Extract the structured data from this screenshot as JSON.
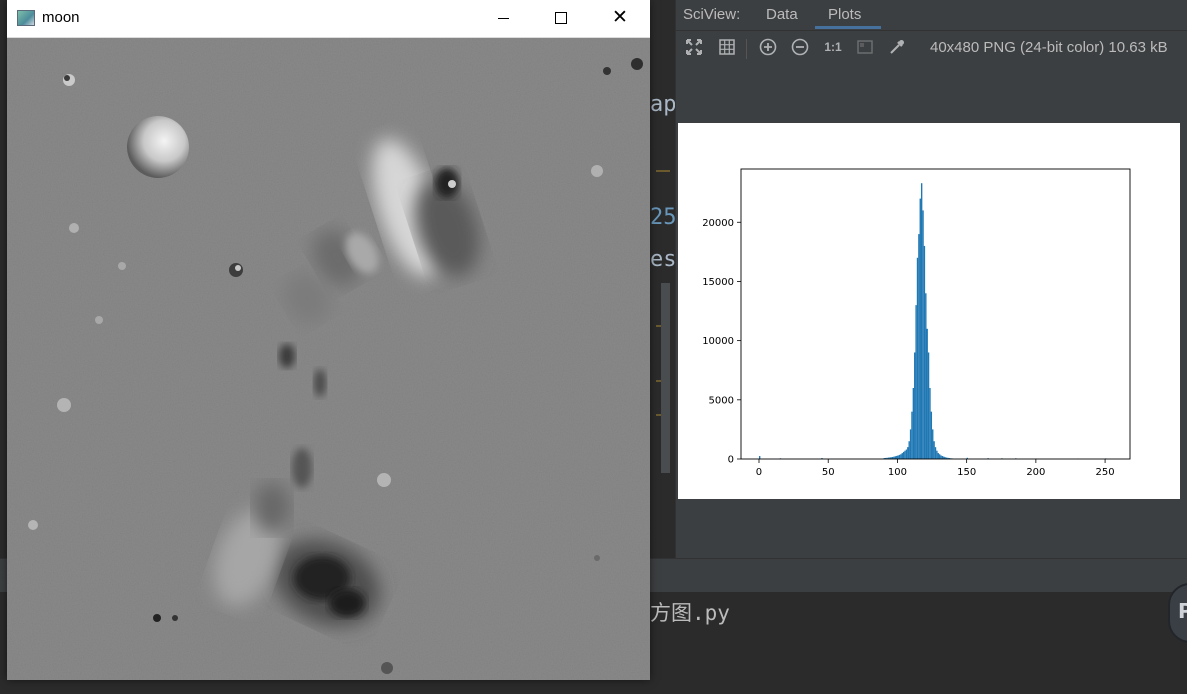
{
  "window": {
    "title": "moon",
    "controls": {
      "minimize": "minimize",
      "maximize": "maximize",
      "close": "close"
    }
  },
  "ide": {
    "fragments": [
      {
        "text": "ap",
        "color": "#a9b7c6"
      },
      {
        "text": "25",
        "color": "#6897bb"
      },
      {
        "text": "es",
        "color": "#a9b7c6"
      }
    ],
    "bottom_text": "方图.py"
  },
  "sciview": {
    "label": "SciView:",
    "tabs": [
      {
        "label": "Data",
        "active": false
      },
      {
        "label": "Plots",
        "active": true
      }
    ],
    "toolbar": {
      "icons": [
        "fit-icon",
        "grid-icon",
        "zoom-in-icon",
        "zoom-out-icon",
        "actual-size-icon",
        "background-icon",
        "color-picker-icon"
      ],
      "actual_size_label": "1:1",
      "image_info": "40x480 PNG (24-bit color) 10.63 kB"
    }
  },
  "chart_data": {
    "type": "bar",
    "title": "",
    "xlabel": "",
    "ylabel": "",
    "xlim": [
      -13,
      268
    ],
    "ylim": [
      0,
      24500
    ],
    "xticks": [
      0,
      50,
      100,
      150,
      200,
      250
    ],
    "yticks": [
      0,
      5000,
      10000,
      15000,
      20000
    ],
    "bar_color": "#1f77b4",
    "bins_start": 90,
    "bin_width": 1,
    "values": [
      80,
      90,
      100,
      120,
      130,
      150,
      170,
      200,
      230,
      260,
      300,
      350,
      400,
      500,
      600,
      700,
      800,
      1000,
      1500,
      2500,
      4000,
      6000,
      9000,
      13000,
      17000,
      19000,
      22000,
      23300,
      21000,
      18000,
      14000,
      11000,
      9000,
      6000,
      4000,
      2500,
      1500,
      1000,
      700,
      500,
      400,
      300,
      250,
      200,
      150,
      120,
      100,
      80,
      60,
      50
    ],
    "baseline_spikes": [
      [
        0,
        250
      ],
      [
        15,
        60
      ],
      [
        45,
        80
      ],
      [
        150,
        100
      ],
      [
        165,
        70
      ],
      [
        175,
        60
      ],
      [
        185,
        60
      ],
      [
        200,
        40
      ],
      [
        230,
        40
      ],
      [
        250,
        50
      ]
    ]
  },
  "colors": {
    "accent": "#4a88c7",
    "panel_bg": "#3c3f41",
    "editor_bg": "#2b2b2b"
  }
}
